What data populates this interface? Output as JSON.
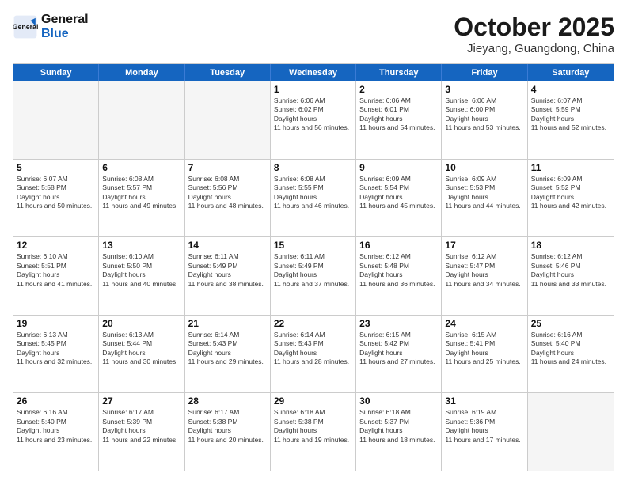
{
  "header": {
    "logo_general": "General",
    "logo_blue": "Blue",
    "month_title": "October 2025",
    "subtitle": "Jieyang, Guangdong, China"
  },
  "weekdays": [
    "Sunday",
    "Monday",
    "Tuesday",
    "Wednesday",
    "Thursday",
    "Friday",
    "Saturday"
  ],
  "rows": [
    [
      {
        "day": "",
        "empty": true
      },
      {
        "day": "",
        "empty": true
      },
      {
        "day": "",
        "empty": true
      },
      {
        "day": "1",
        "sunrise": "6:06 AM",
        "sunset": "6:02 PM",
        "daylight": "11 hours and 56 minutes."
      },
      {
        "day": "2",
        "sunrise": "6:06 AM",
        "sunset": "6:01 PM",
        "daylight": "11 hours and 54 minutes."
      },
      {
        "day": "3",
        "sunrise": "6:06 AM",
        "sunset": "6:00 PM",
        "daylight": "11 hours and 53 minutes."
      },
      {
        "day": "4",
        "sunrise": "6:07 AM",
        "sunset": "5:59 PM",
        "daylight": "11 hours and 52 minutes."
      }
    ],
    [
      {
        "day": "5",
        "sunrise": "6:07 AM",
        "sunset": "5:58 PM",
        "daylight": "11 hours and 50 minutes."
      },
      {
        "day": "6",
        "sunrise": "6:08 AM",
        "sunset": "5:57 PM",
        "daylight": "11 hours and 49 minutes."
      },
      {
        "day": "7",
        "sunrise": "6:08 AM",
        "sunset": "5:56 PM",
        "daylight": "11 hours and 48 minutes."
      },
      {
        "day": "8",
        "sunrise": "6:08 AM",
        "sunset": "5:55 PM",
        "daylight": "11 hours and 46 minutes."
      },
      {
        "day": "9",
        "sunrise": "6:09 AM",
        "sunset": "5:54 PM",
        "daylight": "11 hours and 45 minutes."
      },
      {
        "day": "10",
        "sunrise": "6:09 AM",
        "sunset": "5:53 PM",
        "daylight": "11 hours and 44 minutes."
      },
      {
        "day": "11",
        "sunrise": "6:09 AM",
        "sunset": "5:52 PM",
        "daylight": "11 hours and 42 minutes."
      }
    ],
    [
      {
        "day": "12",
        "sunrise": "6:10 AM",
        "sunset": "5:51 PM",
        "daylight": "11 hours and 41 minutes."
      },
      {
        "day": "13",
        "sunrise": "6:10 AM",
        "sunset": "5:50 PM",
        "daylight": "11 hours and 40 minutes."
      },
      {
        "day": "14",
        "sunrise": "6:11 AM",
        "sunset": "5:49 PM",
        "daylight": "11 hours and 38 minutes."
      },
      {
        "day": "15",
        "sunrise": "6:11 AM",
        "sunset": "5:49 PM",
        "daylight": "11 hours and 37 minutes."
      },
      {
        "day": "16",
        "sunrise": "6:12 AM",
        "sunset": "5:48 PM",
        "daylight": "11 hours and 36 minutes."
      },
      {
        "day": "17",
        "sunrise": "6:12 AM",
        "sunset": "5:47 PM",
        "daylight": "11 hours and 34 minutes."
      },
      {
        "day": "18",
        "sunrise": "6:12 AM",
        "sunset": "5:46 PM",
        "daylight": "11 hours and 33 minutes."
      }
    ],
    [
      {
        "day": "19",
        "sunrise": "6:13 AM",
        "sunset": "5:45 PM",
        "daylight": "11 hours and 32 minutes."
      },
      {
        "day": "20",
        "sunrise": "6:13 AM",
        "sunset": "5:44 PM",
        "daylight": "11 hours and 30 minutes."
      },
      {
        "day": "21",
        "sunrise": "6:14 AM",
        "sunset": "5:43 PM",
        "daylight": "11 hours and 29 minutes."
      },
      {
        "day": "22",
        "sunrise": "6:14 AM",
        "sunset": "5:43 PM",
        "daylight": "11 hours and 28 minutes."
      },
      {
        "day": "23",
        "sunrise": "6:15 AM",
        "sunset": "5:42 PM",
        "daylight": "11 hours and 27 minutes."
      },
      {
        "day": "24",
        "sunrise": "6:15 AM",
        "sunset": "5:41 PM",
        "daylight": "11 hours and 25 minutes."
      },
      {
        "day": "25",
        "sunrise": "6:16 AM",
        "sunset": "5:40 PM",
        "daylight": "11 hours and 24 minutes."
      }
    ],
    [
      {
        "day": "26",
        "sunrise": "6:16 AM",
        "sunset": "5:40 PM",
        "daylight": "11 hours and 23 minutes."
      },
      {
        "day": "27",
        "sunrise": "6:17 AM",
        "sunset": "5:39 PM",
        "daylight": "11 hours and 22 minutes."
      },
      {
        "day": "28",
        "sunrise": "6:17 AM",
        "sunset": "5:38 PM",
        "daylight": "11 hours and 20 minutes."
      },
      {
        "day": "29",
        "sunrise": "6:18 AM",
        "sunset": "5:38 PM",
        "daylight": "11 hours and 19 minutes."
      },
      {
        "day": "30",
        "sunrise": "6:18 AM",
        "sunset": "5:37 PM",
        "daylight": "11 hours and 18 minutes."
      },
      {
        "day": "31",
        "sunrise": "6:19 AM",
        "sunset": "5:36 PM",
        "daylight": "11 hours and 17 minutes."
      },
      {
        "day": "",
        "empty": true
      }
    ]
  ]
}
